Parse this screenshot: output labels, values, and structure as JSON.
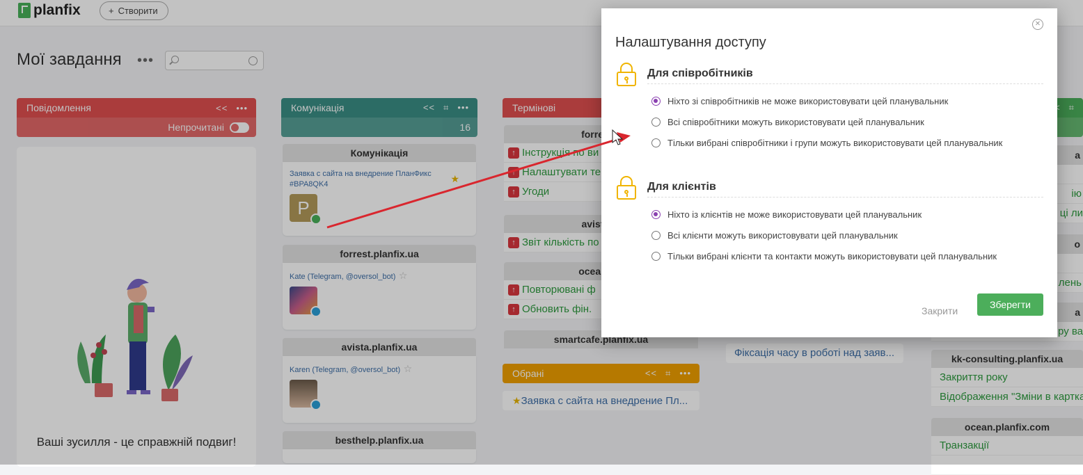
{
  "topbar": {
    "logo_text": "planfix",
    "create_label": "Створити"
  },
  "page": {
    "title": "Мої завдання",
    "more": "•••"
  },
  "columns": {
    "notifications": {
      "title": "Повідомлення",
      "toggle_label": "Непрочитані",
      "color": "#e05050",
      "empty_text": "Ваші зусилля - це справжній подвиг!"
    },
    "communication": {
      "title": "Комунікація",
      "count": "16",
      "color": "#3a8f85",
      "groups": [
        {
          "name": "Комунікація",
          "card": "Заявка с сайта на внедрение ПланФикс #BPA8QK4"
        },
        {
          "name": "forrest.planfix.ua",
          "card": "Kate (Telegram, @oversol_bot)"
        },
        {
          "name": "avista.planfix.ua",
          "card": "Karen (Telegram, @oversol_bot)"
        },
        {
          "name": "besthelp.planfix.ua"
        }
      ]
    },
    "urgent": {
      "title": "Термінові",
      "color": "#e05050",
      "groups": [
        {
          "name": "forrest.p",
          "tasks": [
            "Інструкція по ви",
            "Налаштувати те",
            "Угоди"
          ]
        },
        {
          "name": "avista.pl",
          "tasks": [
            "Звіт кількість по"
          ]
        },
        {
          "name": "ocean.pla",
          "tasks": [
            "Повторювані ф",
            "Обновить фін."
          ]
        },
        {
          "name": "smartcafe.planfix.ua"
        }
      ]
    },
    "favorites": {
      "title": "Обрані",
      "color": "#f0a000",
      "task": "Заявка с сайта на внедрение Пл..."
    },
    "middle": {
      "task": "Фіксація часу в роботі над заяв..."
    },
    "right": {
      "fragments": [
        "а",
        "ію",
        "ці ли",
        "о",
        "лень",
        "а",
        "ру ва"
      ],
      "groups": [
        {
          "name": "kk-consulting.planfix.ua",
          "tasks": [
            "Закриття року",
            "Відображення \"Зміни в картка"
          ]
        },
        {
          "name": "ocean.planfix.com",
          "tasks": [
            "Транзакції"
          ]
        }
      ]
    }
  },
  "modal": {
    "title": "Налаштування доступу",
    "employees": {
      "title": "Для співробітників",
      "options": [
        "Ніхто зі співробітників не може використовувати цей планувальник",
        "Всі співробітники можуть використовувати цей планувальник",
        "Тільки вибрані співробітники і групи можуть використовувати цей планувальник"
      ],
      "selected": 0
    },
    "clients": {
      "title": "Для клієнтів",
      "options": [
        "Ніхто із клієнтів не може використовувати цей планувальник",
        "Всі клієнти можуть використовувати цей планувальник",
        "Тільки вибрані клієнти та контакти можуть використовувати цей планувальник"
      ],
      "selected": 0
    },
    "close_label": "Закрити",
    "save_label": "Зберегти"
  },
  "colors": {
    "accent_green": "#4cae5b",
    "radio_selected": "#8a3fb0",
    "lock": "#f0b400",
    "arrow": "#d9262e"
  }
}
